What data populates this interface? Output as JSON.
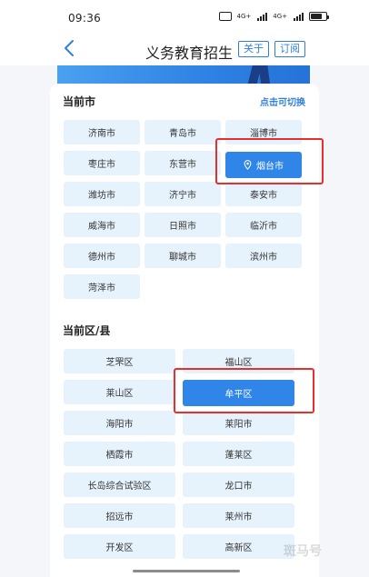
{
  "status_bar": {
    "time": "09:36",
    "net_tag_1": "4G+",
    "net_tag_2": "4G+"
  },
  "nav": {
    "title": "义务教育招生",
    "about_label": "关于",
    "subscribe_label": "订阅"
  },
  "city_section": {
    "title": "当前市",
    "switch_label": "点击可切换",
    "selected": "烟台市",
    "cities": [
      "济南市",
      "青岛市",
      "淄博市",
      "枣庄市",
      "东营市",
      "烟台市",
      "潍坊市",
      "济宁市",
      "泰安市",
      "威海市",
      "日照市",
      "临沂市",
      "德州市",
      "聊城市",
      "滨州市",
      "菏泽市"
    ]
  },
  "district_section": {
    "title": "当前区/县",
    "selected": "牟平区",
    "districts": [
      "芝罘区",
      "福山区",
      "莱山区",
      "牟平区",
      "海阳市",
      "莱阳市",
      "栖霞市",
      "蓬莱区",
      "长岛综合试验区",
      "龙口市",
      "招远市",
      "莱州市",
      "开发区",
      "高新区"
    ]
  },
  "colors": {
    "accent": "#2f86e8",
    "chip_bg": "#e6f2fc",
    "highlight_border": "#e5312d"
  }
}
